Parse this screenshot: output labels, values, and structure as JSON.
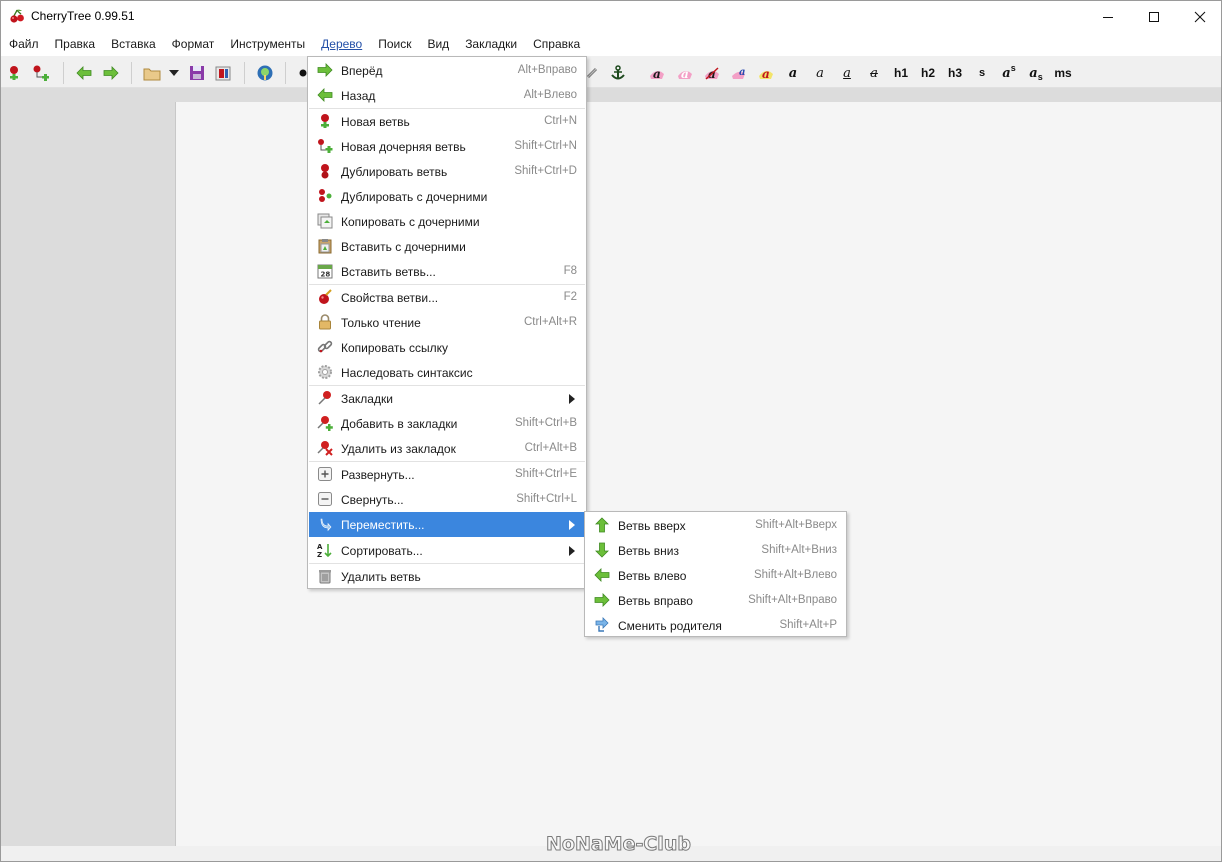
{
  "window": {
    "title": "CherryTree 0.99.51"
  },
  "menubar": {
    "items": [
      "Файл",
      "Правка",
      "Вставка",
      "Формат",
      "Инструменты",
      "Дерево",
      "Поиск",
      "Вид",
      "Закладки",
      "Справка"
    ],
    "active": "Дерево"
  },
  "toolbar": {
    "format_buttons": [
      "a",
      "a",
      "a",
      "a",
      "a",
      "a",
      "a",
      "a",
      "a"
    ],
    "headers": [
      "h1",
      "h2",
      "h3"
    ],
    "small": "s",
    "superscript_base": "a",
    "superscript_mark": "s",
    "subscript_base": "a",
    "subscript_mark": "s",
    "mono": "ms"
  },
  "tree_menu": {
    "items": [
      {
        "label": "Вперёд",
        "shortcut": "Alt+Вправо",
        "icon": "arrow-right-icon"
      },
      {
        "label": "Назад",
        "shortcut": "Alt+Влево",
        "icon": "arrow-left-icon"
      },
      {
        "label": "Новая ветвь",
        "shortcut": "Ctrl+N",
        "icon": "node-add-icon"
      },
      {
        "label": "Новая дочерняя ветвь",
        "shortcut": "Shift+Ctrl+N",
        "icon": "child-node-add-icon"
      },
      {
        "label": "Дублировать ветвь",
        "shortcut": "Shift+Ctrl+D",
        "icon": "duplicate-node-icon"
      },
      {
        "label": "Дублировать с дочерними",
        "shortcut": "",
        "icon": "duplicate-subtree-icon"
      },
      {
        "label": "Копировать с дочерними",
        "shortcut": "",
        "icon": "copy-subtree-icon"
      },
      {
        "label": "Вставить с дочерними",
        "shortcut": "",
        "icon": "paste-subtree-icon"
      },
      {
        "label": "Вставить ветвь...",
        "shortcut": "F8",
        "icon": "calendar-icon"
      },
      {
        "label": "Свойства ветви...",
        "shortcut": "F2",
        "icon": "node-properties-icon"
      },
      {
        "label": "Только чтение",
        "shortcut": "Ctrl+Alt+R",
        "icon": "lock-icon"
      },
      {
        "label": "Копировать ссылку",
        "shortcut": "",
        "icon": "link-icon"
      },
      {
        "label": "Наследовать синтаксис",
        "shortcut": "",
        "icon": "gear-icon"
      },
      {
        "label": "Закладки",
        "shortcut": "",
        "icon": "pin-icon",
        "submenu": true
      },
      {
        "label": "Добавить в закладки",
        "shortcut": "Shift+Ctrl+B",
        "icon": "pin-add-icon"
      },
      {
        "label": "Удалить из закладок",
        "shortcut": "Ctrl+Alt+B",
        "icon": "pin-remove-icon"
      },
      {
        "label": "Развернуть...",
        "shortcut": "Shift+Ctrl+E",
        "icon": "expand-icon"
      },
      {
        "label": "Свернуть...",
        "shortcut": "Shift+Ctrl+L",
        "icon": "collapse-icon"
      },
      {
        "label": "Переместить...",
        "shortcut": "",
        "icon": "move-icon",
        "submenu": true,
        "highlighted": true
      },
      {
        "label": "Сортировать...",
        "shortcut": "",
        "icon": "sort-az-icon",
        "submenu": true
      },
      {
        "label": "Удалить ветвь",
        "shortcut": "",
        "icon": "trash-icon"
      }
    ]
  },
  "move_submenu": {
    "items": [
      {
        "label": "Ветвь вверх",
        "shortcut": "Shift+Alt+Вверх",
        "icon": "arrow-up-icon"
      },
      {
        "label": "Ветвь вниз",
        "shortcut": "Shift+Alt+Вниз",
        "icon": "arrow-down-icon"
      },
      {
        "label": "Ветвь влево",
        "shortcut": "Shift+Alt+Влево",
        "icon": "arrow-left-icon"
      },
      {
        "label": "Ветвь вправо",
        "shortcut": "Shift+Alt+Вправо",
        "icon": "arrow-right-icon"
      },
      {
        "label": "Сменить родителя",
        "shortcut": "Shift+Alt+P",
        "icon": "change-parent-icon"
      }
    ]
  },
  "watermark": "NoNaMe-Club",
  "colors": {
    "highlight": "#3b86de",
    "tree_panel": "#dcdcdc",
    "editor": "#f5f5f5",
    "arrow_green": "#4caf3a",
    "cherry_red": "#c0141c"
  }
}
